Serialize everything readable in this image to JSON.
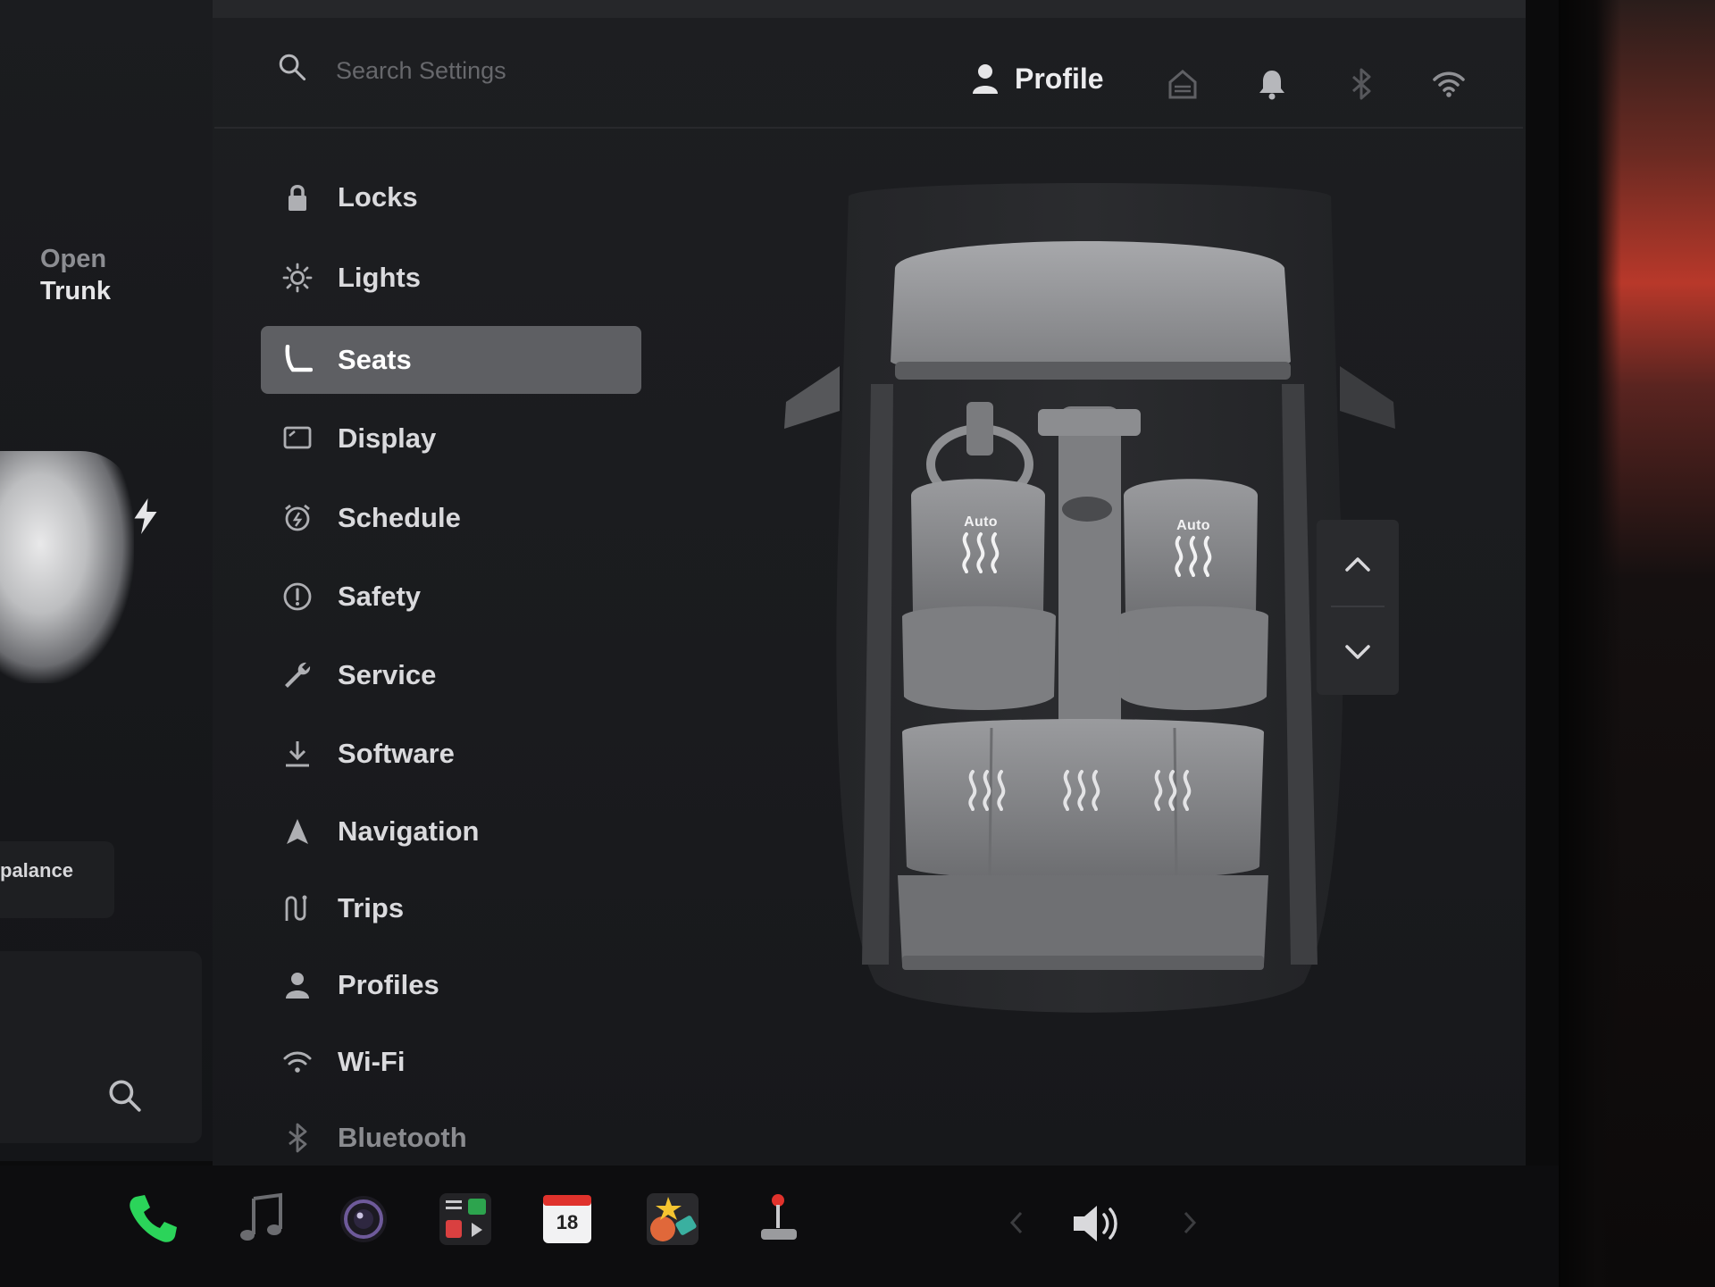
{
  "left_panel": {
    "open_trunk_line1": "Open",
    "open_trunk_line2": "Trunk",
    "balance_label": "palance"
  },
  "header": {
    "search_placeholder": "Search Settings",
    "profile_label": "Profile"
  },
  "menu": {
    "items": [
      {
        "label": "Locks",
        "icon": "lock-icon"
      },
      {
        "label": "Lights",
        "icon": "sun-icon"
      },
      {
        "label": "Seats",
        "icon": "seat-icon",
        "active": true
      },
      {
        "label": "Display",
        "icon": "display-icon"
      },
      {
        "label": "Schedule",
        "icon": "alarm-clock-icon"
      },
      {
        "label": "Safety",
        "icon": "alert-circle-icon"
      },
      {
        "label": "Service",
        "icon": "wrench-icon"
      },
      {
        "label": "Software",
        "icon": "download-icon"
      },
      {
        "label": "Navigation",
        "icon": "navigation-arrow-icon"
      },
      {
        "label": "Trips",
        "icon": "trips-icon"
      },
      {
        "label": "Profiles",
        "icon": "person-icon"
      },
      {
        "label": "Wi-Fi",
        "icon": "wifi-icon"
      },
      {
        "label": "Bluetooth",
        "icon": "bluetooth-icon"
      }
    ]
  },
  "seats": {
    "driver": {
      "mode": "Auto"
    },
    "passenger": {
      "mode": "Auto"
    }
  },
  "dock": {
    "calendar_date": "18"
  },
  "colors": {
    "active_item_bg": "#5e5f63",
    "phone_green": "#2bd45a",
    "panel_bg": "#1d1e21"
  }
}
